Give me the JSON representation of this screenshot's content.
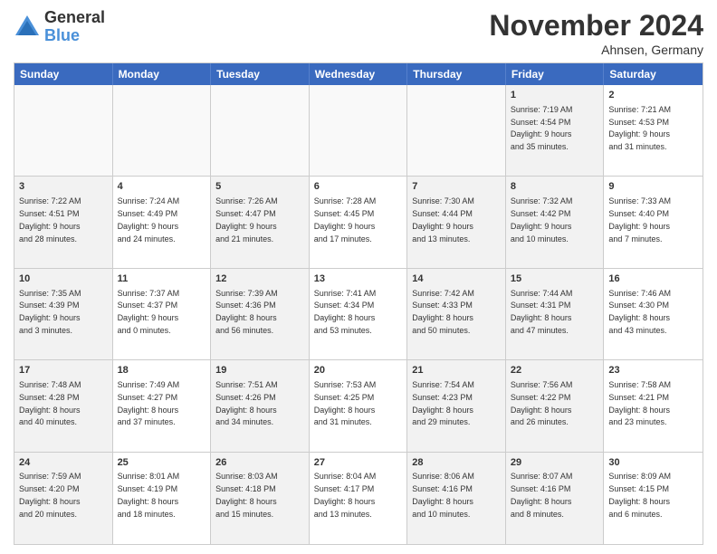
{
  "header": {
    "logo_general": "General",
    "logo_blue": "Blue",
    "month_title": "November 2024",
    "subtitle": "Ahnsen, Germany"
  },
  "weekdays": [
    "Sunday",
    "Monday",
    "Tuesday",
    "Wednesday",
    "Thursday",
    "Friday",
    "Saturday"
  ],
  "weeks": [
    [
      {
        "day": "",
        "text": "",
        "empty": true
      },
      {
        "day": "",
        "text": "",
        "empty": true
      },
      {
        "day": "",
        "text": "",
        "empty": true
      },
      {
        "day": "",
        "text": "",
        "empty": true
      },
      {
        "day": "",
        "text": "",
        "empty": true
      },
      {
        "day": "1",
        "text": "Sunrise: 7:19 AM\nSunset: 4:54 PM\nDaylight: 9 hours\nand 35 minutes.",
        "shaded": true
      },
      {
        "day": "2",
        "text": "Sunrise: 7:21 AM\nSunset: 4:53 PM\nDaylight: 9 hours\nand 31 minutes.",
        "shaded": false
      }
    ],
    [
      {
        "day": "3",
        "text": "Sunrise: 7:22 AM\nSunset: 4:51 PM\nDaylight: 9 hours\nand 28 minutes.",
        "shaded": true
      },
      {
        "day": "4",
        "text": "Sunrise: 7:24 AM\nSunset: 4:49 PM\nDaylight: 9 hours\nand 24 minutes.",
        "shaded": false
      },
      {
        "day": "5",
        "text": "Sunrise: 7:26 AM\nSunset: 4:47 PM\nDaylight: 9 hours\nand 21 minutes.",
        "shaded": true
      },
      {
        "day": "6",
        "text": "Sunrise: 7:28 AM\nSunset: 4:45 PM\nDaylight: 9 hours\nand 17 minutes.",
        "shaded": false
      },
      {
        "day": "7",
        "text": "Sunrise: 7:30 AM\nSunset: 4:44 PM\nDaylight: 9 hours\nand 13 minutes.",
        "shaded": true
      },
      {
        "day": "8",
        "text": "Sunrise: 7:32 AM\nSunset: 4:42 PM\nDaylight: 9 hours\nand 10 minutes.",
        "shaded": true
      },
      {
        "day": "9",
        "text": "Sunrise: 7:33 AM\nSunset: 4:40 PM\nDaylight: 9 hours\nand 7 minutes.",
        "shaded": false
      }
    ],
    [
      {
        "day": "10",
        "text": "Sunrise: 7:35 AM\nSunset: 4:39 PM\nDaylight: 9 hours\nand 3 minutes.",
        "shaded": true
      },
      {
        "day": "11",
        "text": "Sunrise: 7:37 AM\nSunset: 4:37 PM\nDaylight: 9 hours\nand 0 minutes.",
        "shaded": false
      },
      {
        "day": "12",
        "text": "Sunrise: 7:39 AM\nSunset: 4:36 PM\nDaylight: 8 hours\nand 56 minutes.",
        "shaded": true
      },
      {
        "day": "13",
        "text": "Sunrise: 7:41 AM\nSunset: 4:34 PM\nDaylight: 8 hours\nand 53 minutes.",
        "shaded": false
      },
      {
        "day": "14",
        "text": "Sunrise: 7:42 AM\nSunset: 4:33 PM\nDaylight: 8 hours\nand 50 minutes.",
        "shaded": true
      },
      {
        "day": "15",
        "text": "Sunrise: 7:44 AM\nSunset: 4:31 PM\nDaylight: 8 hours\nand 47 minutes.",
        "shaded": true
      },
      {
        "day": "16",
        "text": "Sunrise: 7:46 AM\nSunset: 4:30 PM\nDaylight: 8 hours\nand 43 minutes.",
        "shaded": false
      }
    ],
    [
      {
        "day": "17",
        "text": "Sunrise: 7:48 AM\nSunset: 4:28 PM\nDaylight: 8 hours\nand 40 minutes.",
        "shaded": true
      },
      {
        "day": "18",
        "text": "Sunrise: 7:49 AM\nSunset: 4:27 PM\nDaylight: 8 hours\nand 37 minutes.",
        "shaded": false
      },
      {
        "day": "19",
        "text": "Sunrise: 7:51 AM\nSunset: 4:26 PM\nDaylight: 8 hours\nand 34 minutes.",
        "shaded": true
      },
      {
        "day": "20",
        "text": "Sunrise: 7:53 AM\nSunset: 4:25 PM\nDaylight: 8 hours\nand 31 minutes.",
        "shaded": false
      },
      {
        "day": "21",
        "text": "Sunrise: 7:54 AM\nSunset: 4:23 PM\nDaylight: 8 hours\nand 29 minutes.",
        "shaded": true
      },
      {
        "day": "22",
        "text": "Sunrise: 7:56 AM\nSunset: 4:22 PM\nDaylight: 8 hours\nand 26 minutes.",
        "shaded": true
      },
      {
        "day": "23",
        "text": "Sunrise: 7:58 AM\nSunset: 4:21 PM\nDaylight: 8 hours\nand 23 minutes.",
        "shaded": false
      }
    ],
    [
      {
        "day": "24",
        "text": "Sunrise: 7:59 AM\nSunset: 4:20 PM\nDaylight: 8 hours\nand 20 minutes.",
        "shaded": true
      },
      {
        "day": "25",
        "text": "Sunrise: 8:01 AM\nSunset: 4:19 PM\nDaylight: 8 hours\nand 18 minutes.",
        "shaded": false
      },
      {
        "day": "26",
        "text": "Sunrise: 8:03 AM\nSunset: 4:18 PM\nDaylight: 8 hours\nand 15 minutes.",
        "shaded": true
      },
      {
        "day": "27",
        "text": "Sunrise: 8:04 AM\nSunset: 4:17 PM\nDaylight: 8 hours\nand 13 minutes.",
        "shaded": false
      },
      {
        "day": "28",
        "text": "Sunrise: 8:06 AM\nSunset: 4:16 PM\nDaylight: 8 hours\nand 10 minutes.",
        "shaded": true
      },
      {
        "day": "29",
        "text": "Sunrise: 8:07 AM\nSunset: 4:16 PM\nDaylight: 8 hours\nand 8 minutes.",
        "shaded": true
      },
      {
        "day": "30",
        "text": "Sunrise: 8:09 AM\nSunset: 4:15 PM\nDaylight: 8 hours\nand 6 minutes.",
        "shaded": false
      }
    ]
  ]
}
